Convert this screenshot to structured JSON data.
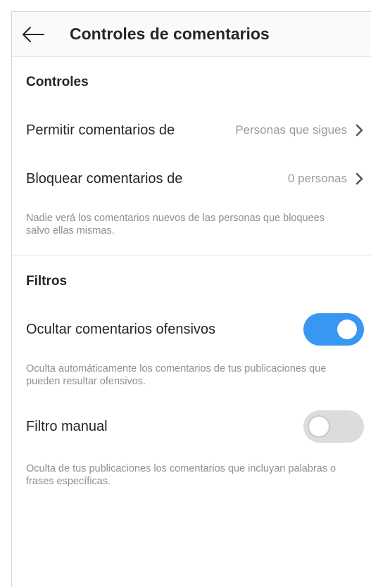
{
  "header": {
    "title": "Controles de comentarios",
    "back_icon": "arrow-left-icon"
  },
  "controls": {
    "title": "Controles",
    "allow_comments": {
      "label": "Permitir comentarios de",
      "value": "Personas que sigues"
    },
    "block_comments": {
      "label": "Bloquear comentarios de",
      "value": "0 personas"
    },
    "note": "Nadie verá los comentarios nuevos de las personas que bloquees salvo ellas mismas."
  },
  "filters": {
    "title": "Filtros",
    "offensive": {
      "label": "Ocultar comentarios ofensivos",
      "enabled": true,
      "note": "Oculta automáticamente los comentarios de tus publicaciones que pueden resultar ofensivos."
    },
    "manual": {
      "label": "Filtro manual",
      "enabled": false,
      "note": "Oculta de tus publicaciones los comentarios que incluyan palabras o frases específicas."
    }
  },
  "colors": {
    "toggle_on": "#3897f0",
    "toggle_off": "#dcdcdc",
    "secondary_text": "#8e8e8e"
  }
}
